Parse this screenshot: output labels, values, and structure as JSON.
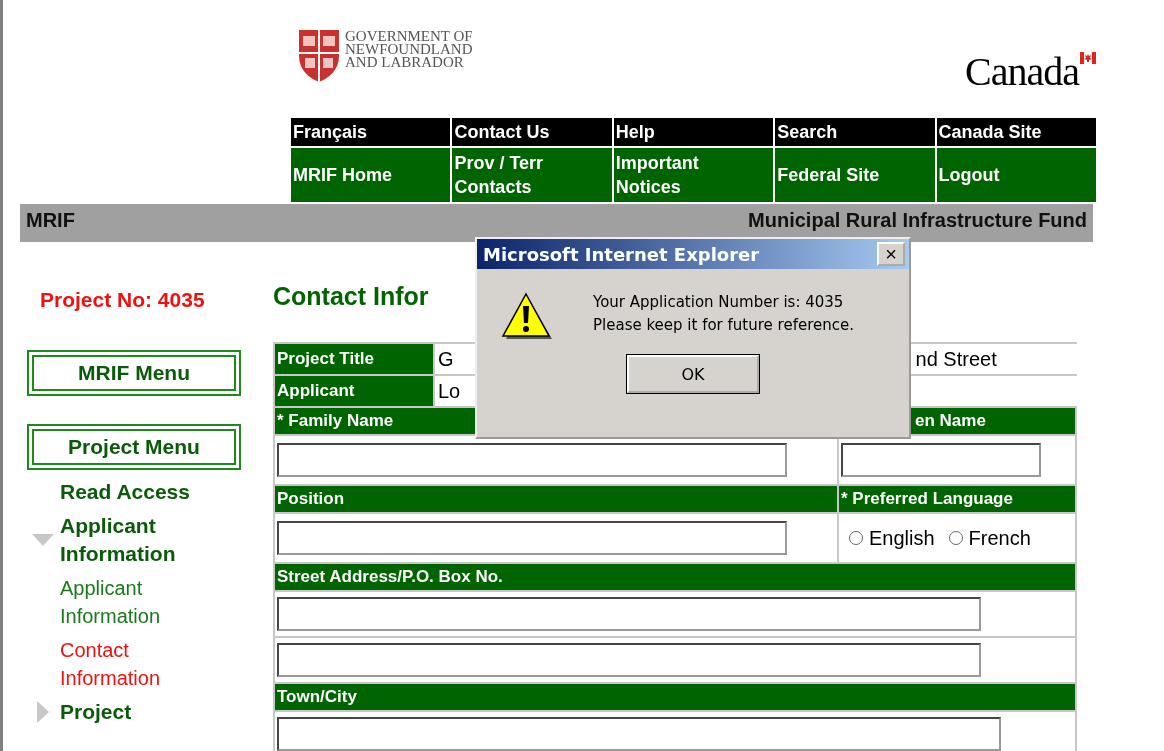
{
  "header": {
    "logo_lines": [
      "GOVERNMENT OF",
      "NEWFOUNDLAND",
      "AND LABRADOR"
    ],
    "wordmark": "Canada"
  },
  "nav": {
    "top": [
      "Français",
      "Contact Us",
      "Help",
      "Search",
      "Canada Site"
    ],
    "bottom": [
      "MRIF Home",
      "Prov / Terr Contacts",
      "Important Notices",
      "Federal Site",
      "Logout"
    ]
  },
  "banner": {
    "left": "MRIF",
    "right": "Municipal Rural Infrastructure Fund"
  },
  "project_no": "Project No:  4035",
  "page_title": "Contact Infor",
  "menu_buttons": [
    "MRIF Menu",
    "Project Menu"
  ],
  "sidebar": [
    {
      "kind": "section",
      "label": "Read Access"
    },
    {
      "kind": "group",
      "label": "Applicant Information",
      "expanded": true
    },
    {
      "kind": "link",
      "label": "Applicant Information",
      "selected": false
    },
    {
      "kind": "link",
      "label": "Contact Information",
      "selected": true
    },
    {
      "kind": "group",
      "label": "Project",
      "expanded": false
    }
  ],
  "form": {
    "info_rows": [
      {
        "label": "Project Title",
        "value_start": "G",
        "value_end": "nd Street"
      },
      {
        "label": "Applicant",
        "value_start": "Lo",
        "value_end": ""
      }
    ],
    "family_name": "* Family Name",
    "given_name": "en Name",
    "position": "Position",
    "language": "* Preferred Language",
    "languages": [
      {
        "label": "English",
        "selected": false
      },
      {
        "label": "French",
        "selected": false
      }
    ],
    "street": "Street Address/P.O. Box No.",
    "town": "Town/City"
  },
  "dialog": {
    "title": "Microsoft Internet Explorer",
    "close": "×",
    "lines": [
      "Your Application Number is: 4035",
      "Please keep it for future reference."
    ],
    "button": "OK"
  }
}
